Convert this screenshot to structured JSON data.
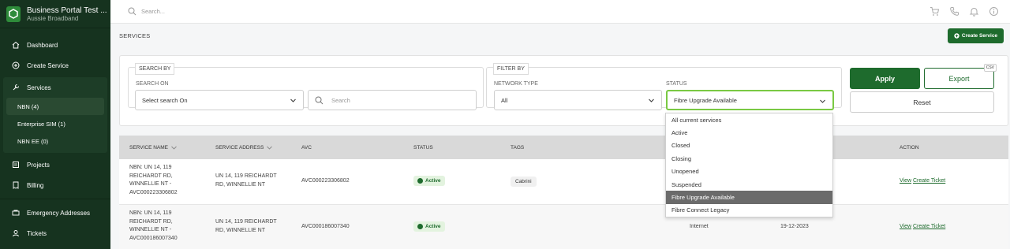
{
  "sidebar": {
    "brand_title": "Business Portal Test ...",
    "brand_subtitle": "Aussie Broadband",
    "items": [
      {
        "label": "Dashboard",
        "icon": "home-icon"
      },
      {
        "label": "Create Service",
        "icon": "plus-circle-icon"
      },
      {
        "label": "Services",
        "icon": "wrench-icon"
      },
      {
        "label": "Projects",
        "icon": "projects-icon"
      },
      {
        "label": "Billing",
        "icon": "billing-icon"
      },
      {
        "label": "Emergency Addresses",
        "icon": "emergency-icon"
      },
      {
        "label": "Tickets",
        "icon": "tickets-icon"
      }
    ],
    "services_sub": [
      {
        "label": "NBN (4)"
      },
      {
        "label": "Enterprise SIM (1)"
      },
      {
        "label": "NBN EE (0)"
      }
    ]
  },
  "header": {
    "search_placeholder": "Search...",
    "icons": [
      "cart-icon",
      "phone-icon",
      "bell-icon",
      "info-icon"
    ]
  },
  "page": {
    "title": "SERVICES",
    "create_button": "Create Service"
  },
  "filters": {
    "search_by_legend": "SEARCH BY",
    "search_on_label": "SEARCH ON",
    "search_on_value": "Select search On",
    "search_placeholder": "Search",
    "filter_by_legend": "FILTER BY",
    "network_type_label": "NETWORK TYPE",
    "network_type_value": "All",
    "status_label": "STATUS",
    "status_value": "Fibre Upgrade Available",
    "apply": "Apply",
    "export": "Export",
    "csv": "CSV",
    "reset": "Reset"
  },
  "status_options": [
    "All current services",
    "Active",
    "Closed",
    "Closing",
    "Unopened",
    "Suspended",
    "Fibre Upgrade Available",
    "Fibre Connect Legacy"
  ],
  "table": {
    "headers": {
      "service_name": "SERVICE NAME",
      "service_address": "SERVICE ADDRESS",
      "avc": "AVC",
      "status": "STATUS",
      "tags": "TAGS",
      "action": "ACTION"
    },
    "rows": [
      {
        "name_l1": "NBN: UN 14, 119",
        "name_l2": "REICHARDT RD,",
        "name_l3": "WINNELLIE NT -",
        "name_l4": "AVC000223306802",
        "addr_l1": "UN 14, 119 REICHARDT",
        "addr_l2": "RD, WINNELLIE NT",
        "avc": "AVC000223306802",
        "status": "Active",
        "tag": "Cabrini",
        "type": "",
        "date": "",
        "view": "View",
        "ticket": "Create Ticket"
      },
      {
        "name_l1": "NBN: UN 14, 119",
        "name_l2": "REICHARDT RD,",
        "name_l3": "WINNELLIE NT -",
        "name_l4": "AVC000186007340",
        "addr_l1": "UN 14, 119 REICHARDT",
        "addr_l2": "RD, WINNELLIE NT",
        "avc": "AVC000186007340",
        "status": "Active",
        "tag": "",
        "type": "Internet",
        "date": "19-12-2023",
        "view": "View",
        "ticket": "Create Ticket"
      }
    ]
  },
  "colors": {
    "sidebar_bg": "#16331f",
    "primary_green": "#1e6b2d",
    "focus_green": "#7ac943"
  }
}
